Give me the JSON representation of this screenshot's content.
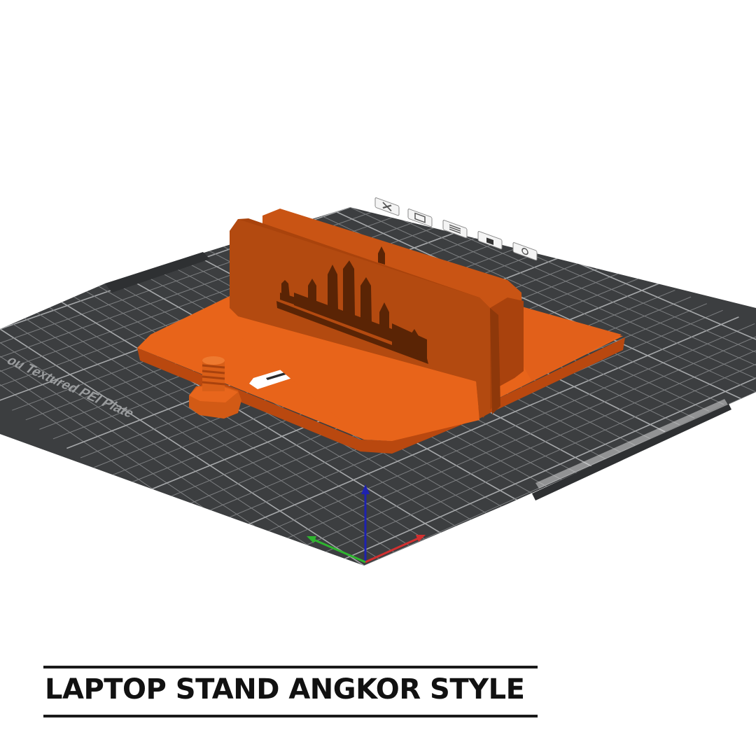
{
  "caption": {
    "title": "LAPTOP STAND ANGKOR STYLE"
  },
  "plate": {
    "name": "Bambu Textured PEI Plate",
    "name_visible": "ou Textured PEI Plate"
  },
  "plate_toolbar": {
    "icons": [
      "close-icon",
      "arrange-icon",
      "slice-plate-icon",
      "lock-icon",
      "settings-icon"
    ]
  },
  "axes": {
    "x_color": "#d23030",
    "y_color": "#2fb52f",
    "z_color": "#1e22b0"
  },
  "colors": {
    "model": "#e8641a",
    "model_shadow": "#b9480f",
    "plate": "#3c3e40",
    "grid": "#8a8c8e"
  }
}
